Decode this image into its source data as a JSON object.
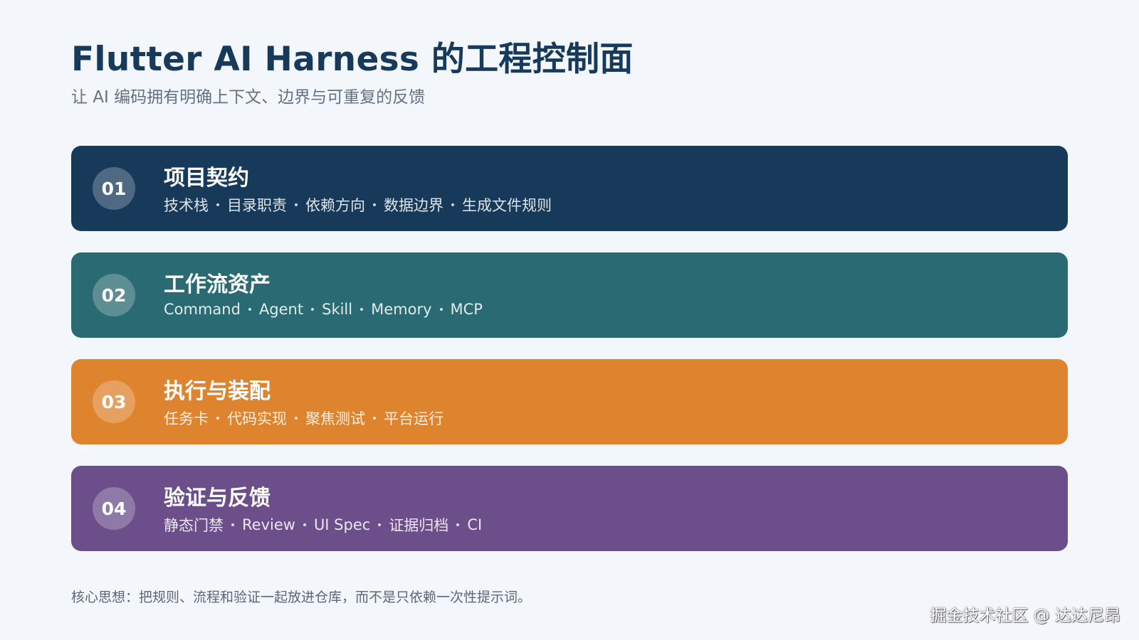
{
  "header": {
    "title": "Flutter AI Harness 的工程控制面",
    "subtitle": "让 AI 编码拥有明确上下文、边界与可重复的反馈"
  },
  "cards": [
    {
      "number": "01",
      "title": "项目契约",
      "color": "#173a5a",
      "items": [
        "技术栈",
        "目录职责",
        "依赖方向",
        "数据边界",
        "生成文件规则"
      ]
    },
    {
      "number": "02",
      "title": "工作流资产",
      "color": "#2a6b73",
      "items": [
        "Command",
        "Agent",
        "Skill",
        "Memory",
        "MCP"
      ]
    },
    {
      "number": "03",
      "title": "执行与装配",
      "color": "#df842e",
      "items": [
        "任务卡",
        "代码实现",
        "聚焦测试",
        "平台运行"
      ]
    },
    {
      "number": "04",
      "title": "验证与反馈",
      "color": "#6c4f8a",
      "items": [
        "静态门禁",
        "Review",
        "UI Spec",
        "证据归档",
        "CI"
      ]
    }
  ],
  "footer": {
    "note": "核心思想：把规则、流程和验证一起放进仓库，而不是只依赖一次性提示词。",
    "watermark": "掘金技术社区 @ 达达尼昂"
  }
}
